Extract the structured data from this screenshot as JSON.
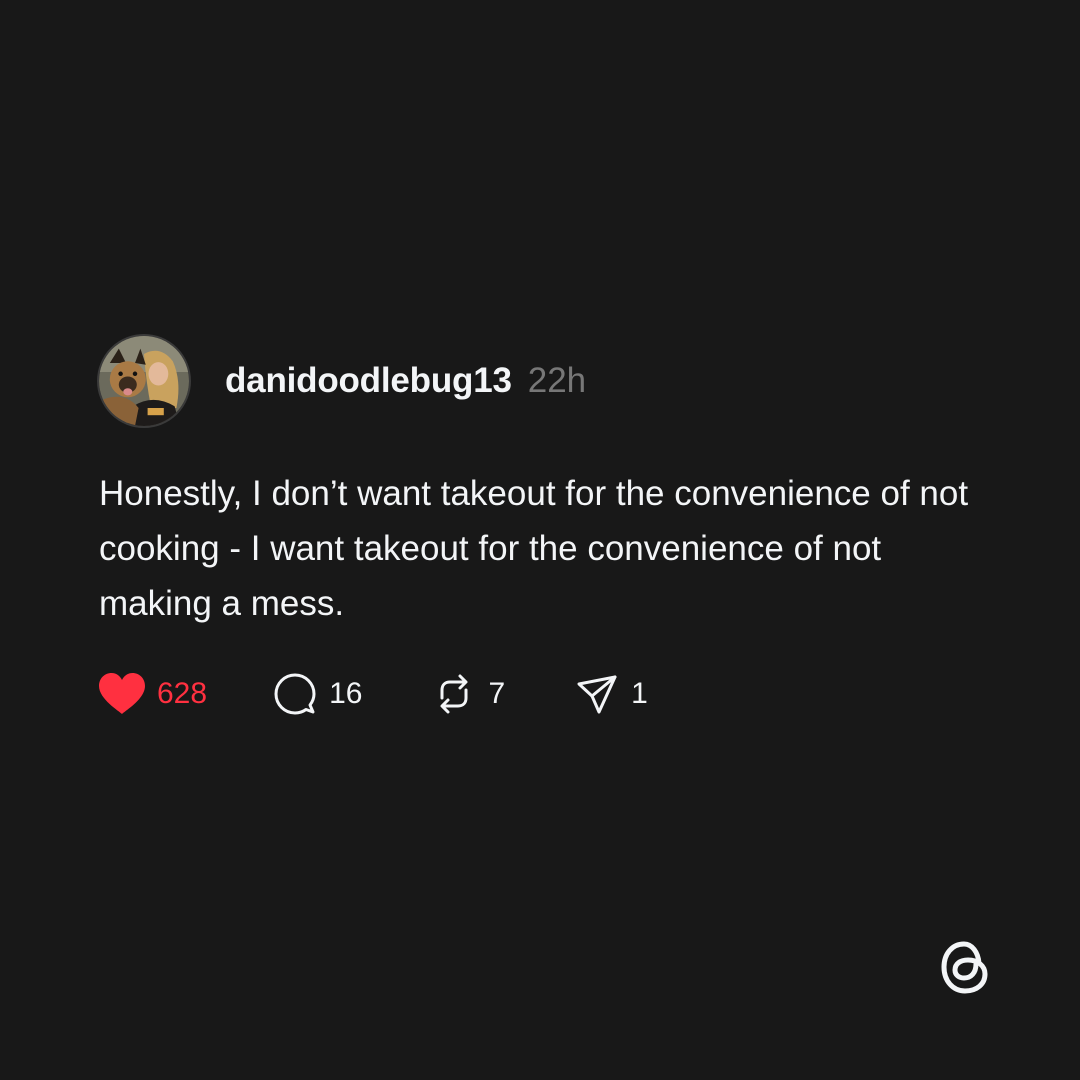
{
  "post": {
    "username": "danidoodlebug13",
    "timestamp": "22h",
    "text": "Honestly, I don’t want takeout for the convenience of not cooking - I want takeout for the convenience of not making a mess.",
    "likes": "628",
    "replies": "16",
    "reposts": "7",
    "shares": "1"
  },
  "icons": {
    "like": "heart-icon",
    "reply": "speech-bubble-icon",
    "repost": "repost-arrows-icon",
    "share": "paper-plane-icon",
    "brand": "threads-logo"
  },
  "colors": {
    "background": "#181818",
    "text": "#f3f5f7",
    "muted": "#777777",
    "like": "#ff3040"
  }
}
